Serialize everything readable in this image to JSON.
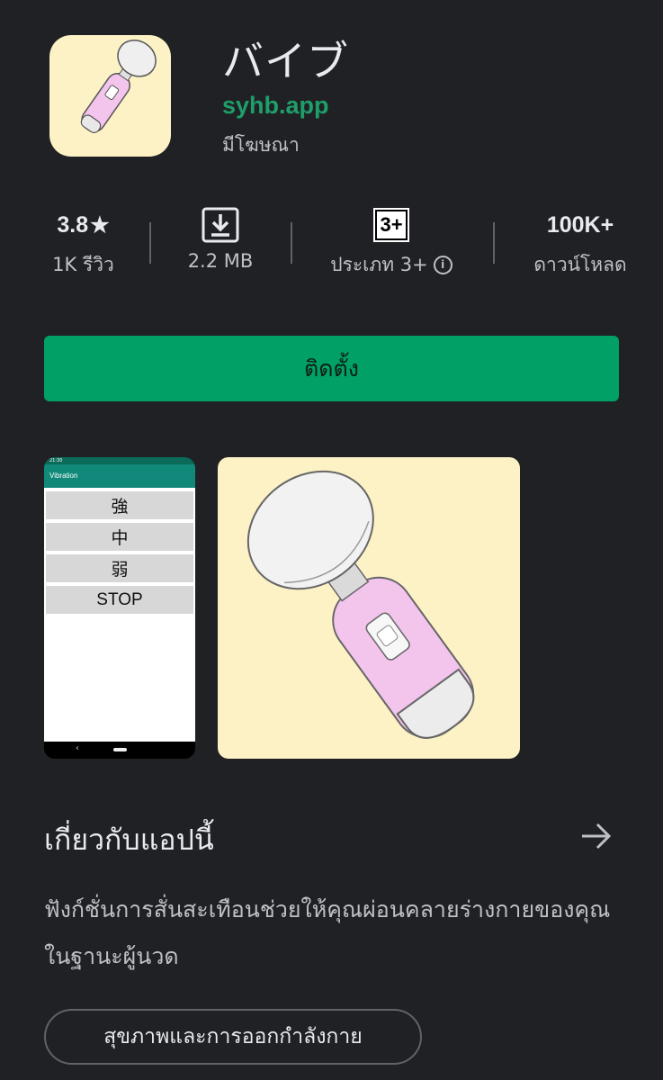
{
  "app": {
    "title": "バイブ",
    "developer": "syhb.app",
    "ads_label": "มีโฆษณา"
  },
  "stats": {
    "rating_value": "3.8",
    "rating_star": "★",
    "reviews": "1K รีวิว",
    "size": "2.2 MB",
    "age_badge": "3+",
    "age_label": "ประเภท 3+",
    "downloads_value": "100K+",
    "downloads_label": "ดาวน์โหลด"
  },
  "install": {
    "label": "ติดตั้ง"
  },
  "screenshot_phone": {
    "status_time": "21:30",
    "app_bar_title": "Vibration",
    "buttons": [
      "強",
      "中",
      "弱",
      "STOP"
    ]
  },
  "about": {
    "title": "เกี่ยวกับแอปนี้",
    "arrow_icon": "arrow-right-icon",
    "description": "ฟังก์ชั่นการสั่นสะเทือนช่วยให้คุณผ่อนคลายร่างกายของคุณในฐานะผู้นวด"
  },
  "category": {
    "label": "สุขภาพและการออกกำลังกาย"
  },
  "colors": {
    "background": "#202124",
    "accent_green": "#01a067",
    "developer_green": "#1e9e6a",
    "icon_background": "#fdf2c6",
    "device_pink": "#f3c4ec"
  }
}
